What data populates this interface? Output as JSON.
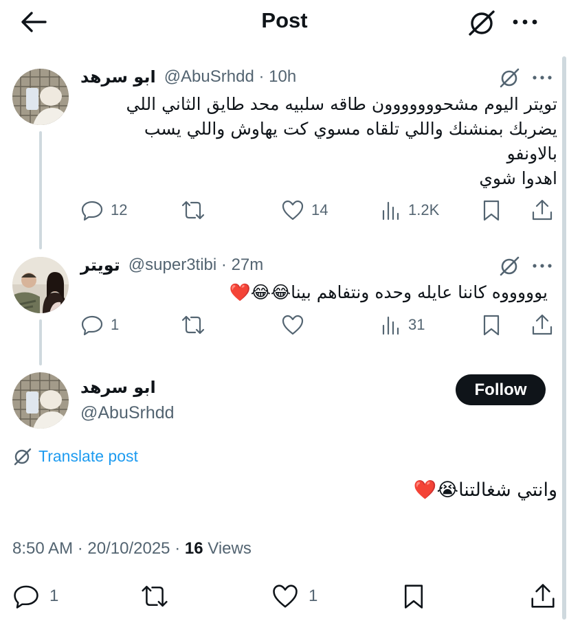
{
  "header": {
    "title": "Post"
  },
  "thread": [
    {
      "name": "ابو سرهد",
      "handle": "@AbuSrhdd",
      "time": "10h",
      "text": "تويتر اليوم مشحووووووون طاقه سلبيه محد طايق الثاني اللي\nيضربك بمنشنك واللي تلقاه مسوي كت يهاوش واللي يسب\nبالاونفو\nاهدوا شوي",
      "replies": "12",
      "reposts": "",
      "likes": "14",
      "views": "1.2K"
    },
    {
      "name": "تويتر",
      "handle": "@super3tibi",
      "time": "27m",
      "text": "يوووووه كاننا عايله وحده ونتفاهم بينا😂😂❤️",
      "replies": "1",
      "reposts": "",
      "likes": "",
      "views": "31"
    }
  ],
  "main_post": {
    "name": "ابو سرهد",
    "handle": "@AbuSrhdd",
    "follow_label": "Follow",
    "translate_label": "Translate post",
    "text": "وانتي شغالتنا😭❤️",
    "time": "8:50 AM",
    "date": "20/10/2025",
    "views_count": "16",
    "views_label": "Views",
    "replies": "1",
    "likes": "1"
  },
  "icons": [
    "back-arrow-icon",
    "grok-icon",
    "more-icon",
    "reply-icon",
    "repost-icon",
    "like-icon",
    "views-icon",
    "bookmark-icon",
    "share-icon",
    "translate-icon"
  ],
  "colors": {
    "accent": "#1d9bf0",
    "text": "#0f1419",
    "muted": "#536471",
    "line": "#cfd9de"
  }
}
